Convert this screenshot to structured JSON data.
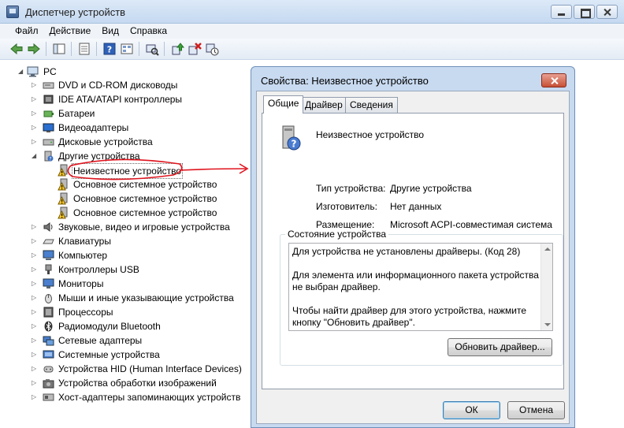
{
  "window": {
    "title": "Диспетчер устройств"
  },
  "menu": [
    "Файл",
    "Действие",
    "Вид",
    "Справка"
  ],
  "tree": {
    "root": "PC",
    "categories": [
      "DVD и CD-ROM дисководы",
      "IDE ATA/ATAPI контроллеры",
      "Батареи",
      "Видеоадаптеры",
      "Дисковые устройства",
      "Другие устройства"
    ],
    "other_devices": [
      "Неизвестное устройство",
      "Основное системное устройство",
      "Основное системное устройство",
      "Основное системное устройство"
    ],
    "categories_after": [
      "Звуковые, видео и игровые устройства",
      "Клавиатуры",
      "Компьютер",
      "Контроллеры USB",
      "Мониторы",
      "Мыши и иные указывающие устройства",
      "Процессоры",
      "Радиомодули Bluetooth",
      "Сетевые адаптеры",
      "Системные устройства",
      "Устройства HID (Human Interface Devices)",
      "Устройства обработки изображений",
      "Хост-адаптеры запоминающих устройств"
    ]
  },
  "dialog": {
    "title": "Свойства: Неизвестное устройство",
    "tabs": [
      "Общие",
      "Драйвер",
      "Сведения"
    ],
    "device_name": "Неизвестное устройство",
    "props": {
      "type_label": "Тип устройства:",
      "type_value": "Другие устройства",
      "manufacturer_label": "Изготовитель:",
      "manufacturer_value": "Нет данных",
      "location_label": "Размещение:",
      "location_value": "Microsoft ACPI-совместимая система"
    },
    "status": {
      "legend": "Состояние устройства",
      "line1": "Для устройства не установлены драйверы. (Код 28)",
      "line2": "Для элемента или информационного пакета устройства не выбран драйвер.",
      "line3": "Чтобы найти драйвер для этого устройства, нажмите кнопку \"Обновить драйвер\"."
    },
    "update_driver_button": "Обновить драйвер...",
    "ok_button": "ОК",
    "cancel_button": "Отмена"
  },
  "colors": {
    "annotation_red": "#e0141e",
    "window_frame": "#c8daf0"
  }
}
